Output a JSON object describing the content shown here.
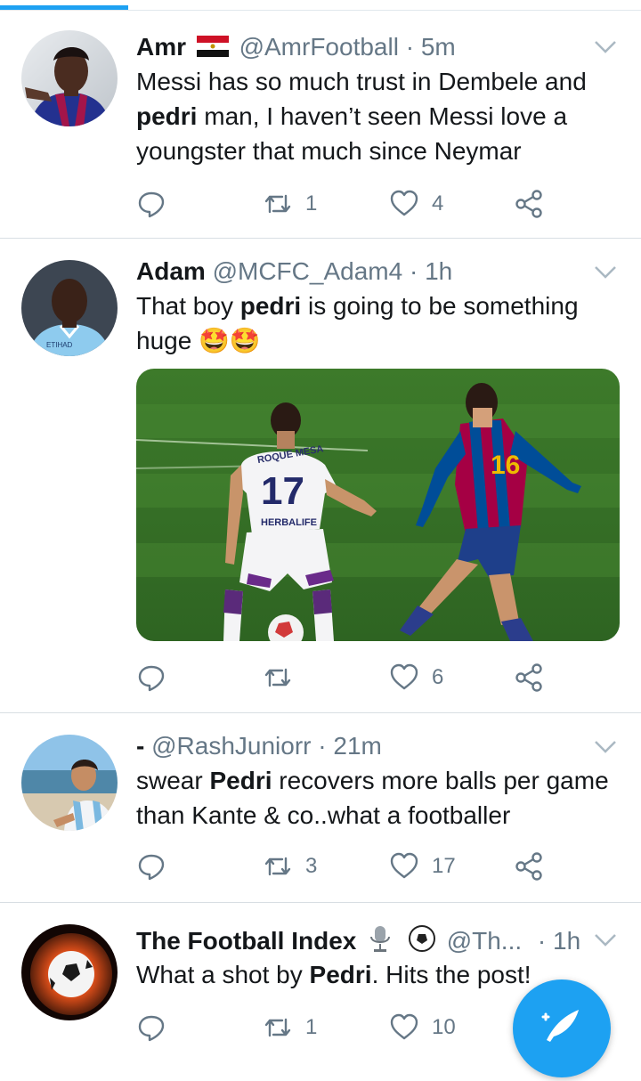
{
  "tweets": [
    {
      "name": "Amr",
      "name_emoji": "egypt-flag",
      "handle": "@AmrFootball",
      "dot": "·",
      "time": "5m",
      "body": [
        "Messi has so much trust in Dembele and ",
        "pedri",
        " man, I haven’t seen Messi love a youngster that much since Neymar"
      ],
      "reply_count": "",
      "retweet_count": "1",
      "like_count": "4"
    },
    {
      "name": "Adam",
      "handle": "@MCFC_Adam4",
      "dot": "·",
      "time": "1h",
      "body": [
        "That boy ",
        "pedri",
        " is going to be something huge 🤩🤩"
      ],
      "reply_count": "",
      "retweet_count": "",
      "like_count": "6",
      "media": {
        "jersey_left_text": "ROQUE MESA",
        "jersey_left_number": "17",
        "jersey_left_sponsor": "HERBALIFE"
      }
    },
    {
      "name": "-",
      "handle": "@RashJuniorr",
      "dot": "·",
      "time": "21m",
      "body": [
        "swear ",
        "Pedri",
        " recovers more balls per game than Kante & co..what a footballer"
      ],
      "reply_count": "",
      "retweet_count": "3",
      "like_count": "17"
    },
    {
      "name": "The Football Index",
      "name_emojis": [
        "microphone",
        "soccer-ball"
      ],
      "handle": "@Th...",
      "dot": "·",
      "time": "1h",
      "body": [
        "What a shot by ",
        "Pedri",
        ". Hits the post!"
      ],
      "reply_count": "",
      "retweet_count": "1",
      "like_count": "10"
    }
  ],
  "avatar_badge_text": "ETIHAD",
  "colors": {
    "accent": "#1da1f2",
    "secondary_text": "#657786",
    "icon": "#657786",
    "divider": "#d8dee3"
  }
}
